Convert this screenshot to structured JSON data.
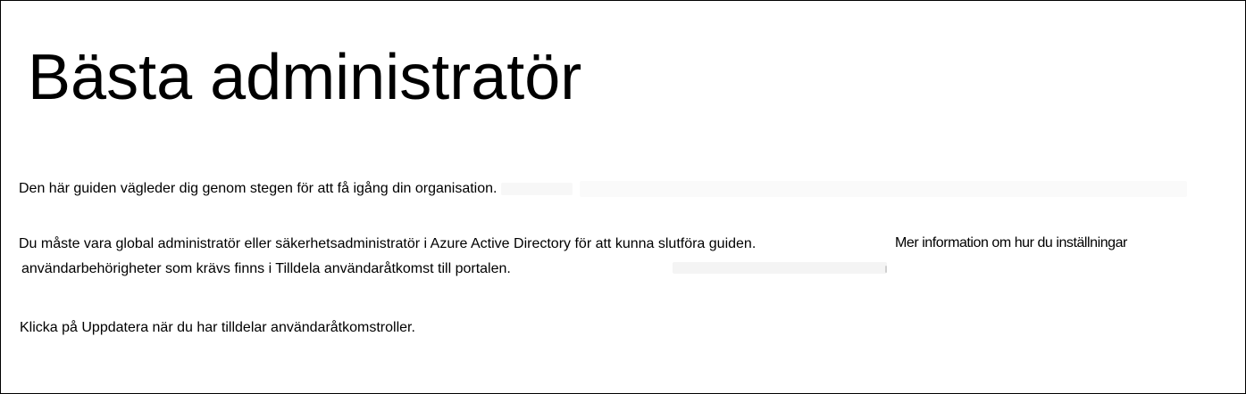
{
  "page": {
    "title": "Bästa administratör",
    "intro": "Den här guiden vägleder dig genom stegen för att få igång din organisation.",
    "requirement_line1": "Du måste vara global administratör eller säkerhetsadministratör i Azure Active Directory för att kunna slutföra guiden.",
    "requirement_line2": "användarbehörigheter som krävs finns i Tilldela användaråtkomst till portalen.",
    "more_info": "Mer information om hur du inställningar",
    "refresh_hint": "Klicka på Uppdatera när du har tilldelar användaråtkomstroller."
  }
}
